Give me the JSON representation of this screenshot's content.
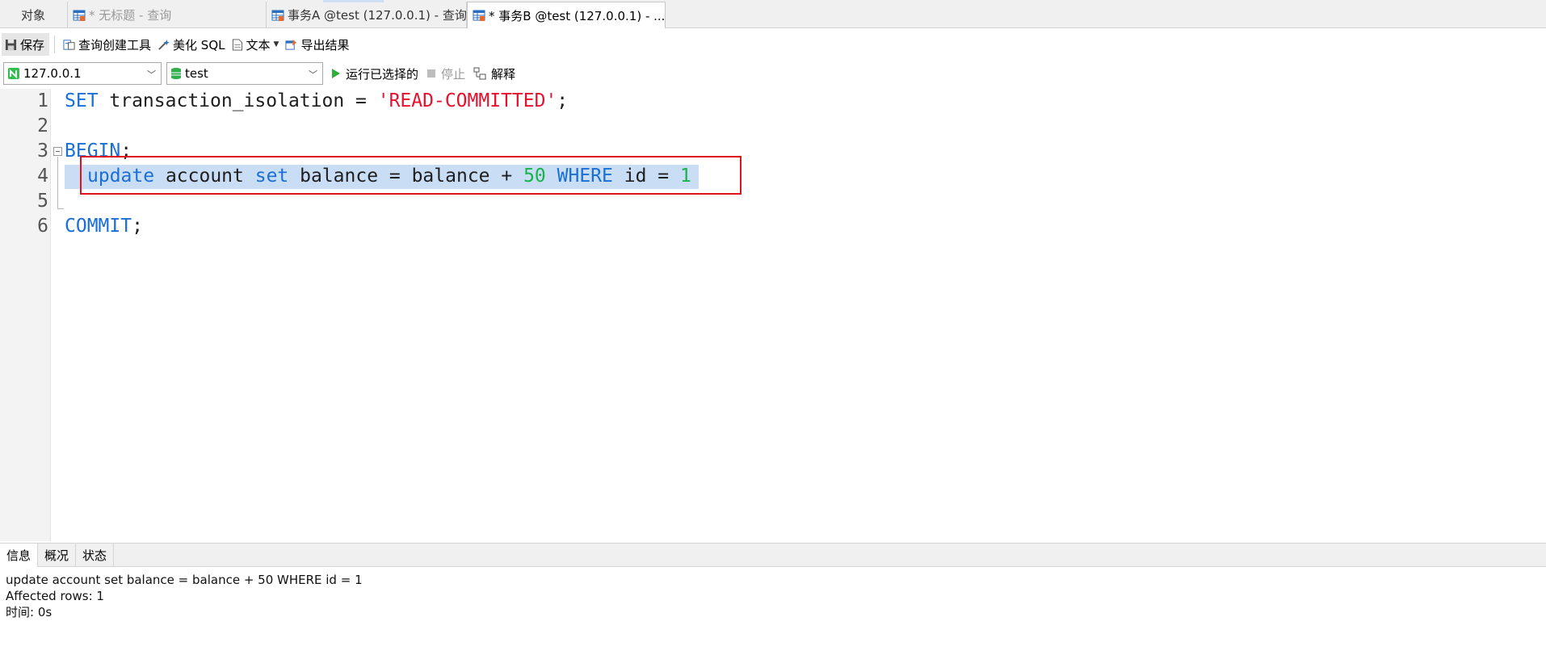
{
  "tabs": [
    {
      "label": "对象",
      "icon": "none",
      "active": false
    },
    {
      "label": "* 无标题 - 查询",
      "icon": "query-table-icon",
      "active": false
    },
    {
      "label": "事务A @test (127.0.0.1) - 查询",
      "icon": "query-table-icon",
      "active": false
    },
    {
      "label": "* 事务B @test (127.0.0.1) - ...",
      "icon": "query-table-icon",
      "active": true
    }
  ],
  "toolbar": {
    "save": "保存",
    "query_builder": "查询创建工具",
    "beautify": "美化 SQL",
    "text": "文本",
    "export": "导出结果"
  },
  "connection": {
    "host": "127.0.0.1",
    "database": "test",
    "run_selected": "运行已选择的",
    "stop": "停止",
    "explain": "解释"
  },
  "editor": {
    "line_numbers": [
      "1",
      "2",
      "3",
      "4",
      "5",
      "6"
    ],
    "lines": {
      "l1": {
        "kw": "SET",
        "mid": " transaction_isolation = ",
        "str": "'READ-COMMITTED'",
        "end": ";"
      },
      "l3": {
        "kw": "BEGIN",
        "end": ";"
      },
      "l4": {
        "kw1": "update",
        "t1": " account ",
        "kw2": "set",
        "t2": " balance = balance + ",
        "num1": "50",
        "sp": " ",
        "kw3": "WHERE",
        "t3": " id = ",
        "num2": "1"
      },
      "l6": {
        "kw": "COMMIT",
        "end": ";"
      }
    }
  },
  "bottom_tabs": [
    "信息",
    "概况",
    "状态"
  ],
  "output": {
    "line1": "update account set balance = balance + 50 WHERE id = 1",
    "line2": "Affected rows: 1",
    "line3": "时间: 0s"
  },
  "colors": {
    "keyword": "#1a6fd6",
    "string": "#e8112d",
    "number": "#18b34b",
    "highlight_box": "#e0121c",
    "selection": "#c9ddf5"
  }
}
